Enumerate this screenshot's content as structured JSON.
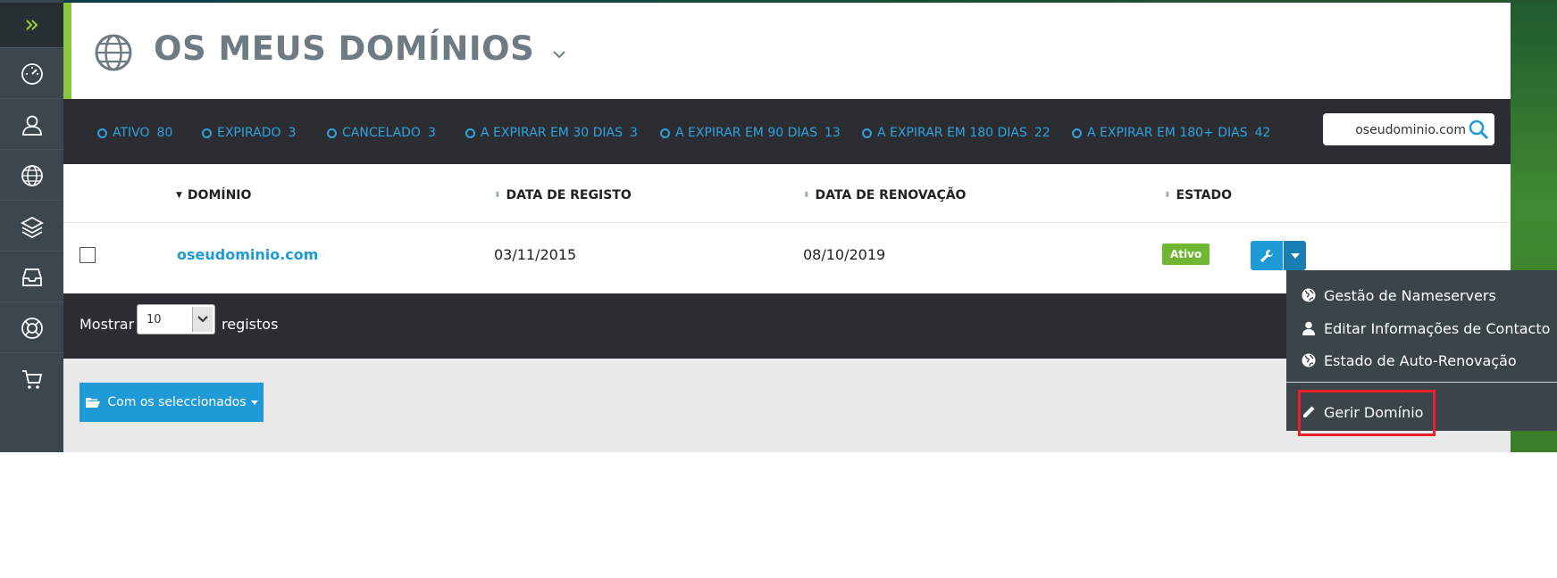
{
  "header": {
    "title": "OS MEUS DOMÍNIOS"
  },
  "filters": [
    {
      "label": "ATIVO",
      "count": "80"
    },
    {
      "label": "EXPIRADO",
      "count": "3"
    },
    {
      "label": "CANCELADO",
      "count": "3"
    },
    {
      "label": "A EXPIRAR EM 30 DIAS",
      "count": "3"
    },
    {
      "label": "A EXPIRAR EM 90 DIAS",
      "count": "13"
    },
    {
      "label": "A EXPIRAR EM 180 DIAS",
      "count": "22"
    },
    {
      "label": "A EXPIRAR EM 180+ DIAS",
      "count": "42"
    }
  ],
  "search": {
    "value": "oseudominio.com"
  },
  "table": {
    "columns": [
      "DOMÍNIO",
      "DATA DE REGISTO",
      "DATA DE RENOVAÇÃO",
      "ESTADO"
    ],
    "rows": [
      {
        "domain": "oseudominio.com",
        "registered": "03/11/2015",
        "renewal": "08/10/2019",
        "status": "Ativo"
      }
    ]
  },
  "footer": {
    "show_label": "Mostrar",
    "page_size": "10",
    "records_label": "registos"
  },
  "bulk": {
    "label": "Com os seleccionados"
  },
  "menu": {
    "items": [
      "Gestão de Nameservers",
      "Editar Informações de Contacto",
      "Estado de Auto-Renovação"
    ],
    "manage": "Gerir Domínio"
  },
  "colors": {
    "accent": "#1e9ad6",
    "brand_green": "#8cc63f",
    "status_active": "#6fb733",
    "dark_bar": "#2c2c33",
    "highlight": "#e8212b"
  }
}
